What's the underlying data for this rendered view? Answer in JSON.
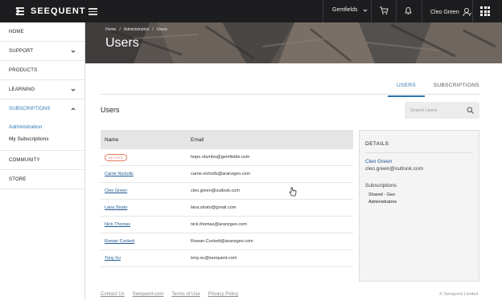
{
  "header": {
    "brand": "SEEQUENT",
    "tenant": "Gemfields",
    "user_name": "Cleo Green"
  },
  "sidebar": {
    "items": [
      {
        "label": "HOME"
      },
      {
        "label": "SUPPORT"
      },
      {
        "label": "PRODUCTS"
      },
      {
        "label": "LEARNING"
      },
      {
        "label": "SUBSCRIPTIONS"
      },
      {
        "label": "COMMUNITY"
      },
      {
        "label": "STORE"
      }
    ],
    "sub_items": [
      {
        "label": "Administration"
      },
      {
        "label": "My Subscriptions"
      }
    ]
  },
  "hero": {
    "breadcrumb": [
      "Home",
      "/",
      "Administration",
      "/",
      "Users"
    ],
    "title": "Users"
  },
  "tabs": [
    {
      "label": "USERS"
    },
    {
      "label": "SUBSCRIPTIONS"
    }
  ],
  "main": {
    "title": "Users",
    "search_placeholder": "Search Users"
  },
  "table": {
    "columns": [
      "Name",
      "Email"
    ],
    "rows": [
      {
        "name": "INVITED",
        "email": "hope.otumbo@gemfields.com"
      },
      {
        "name": "Carrie Nicholls",
        "email": "carrie.nicholls@aranzgeo.com"
      },
      {
        "name": "Cleo Green",
        "email": "cleo.green@outlook.com"
      },
      {
        "name": "Lana Strato",
        "email": "lana.strato@gmail.com"
      },
      {
        "name": "Nick Thomas",
        "email": "nick.thomas@aranzgeo.com"
      },
      {
        "name": "Rowan Cockett",
        "email": "Rowan.Cockett@aranzgeo.com"
      },
      {
        "name": "Tony Xu",
        "email": "tony.xu@seequent.com"
      }
    ]
  },
  "details": {
    "heading": "DETAILS",
    "name": "Cleo Green",
    "email": "cleo.green@outlook.com",
    "subscriptions_label": "Subscriptions",
    "subscriptions": [
      "Shared - Geo",
      "Administrators"
    ]
  },
  "footer": {
    "links": [
      "Contact Us",
      "Seequent.com",
      "Terms of Use",
      "Privacy Policy"
    ],
    "copyright": "© Seequent Limited"
  },
  "colors": {
    "accent": "#2c74b3",
    "link": "#1f5a93",
    "invited_badge": "#e47b5a",
    "topbar": "#1d1d1f"
  }
}
